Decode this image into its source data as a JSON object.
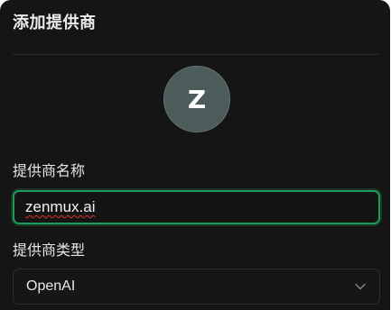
{
  "dialog": {
    "title": "添加提供商"
  },
  "avatar": {
    "initial": "Z"
  },
  "form": {
    "name_label": "提供商名称",
    "name_value": "zenmux.ai",
    "type_label": "提供商类型",
    "type_value": "OpenAI"
  },
  "icons": {
    "select_chevron": "chevron-down-icon"
  },
  "colors": {
    "background": "#151515",
    "focus_border": "#1f9a5c",
    "avatar_bg": "#4c5c5a"
  }
}
